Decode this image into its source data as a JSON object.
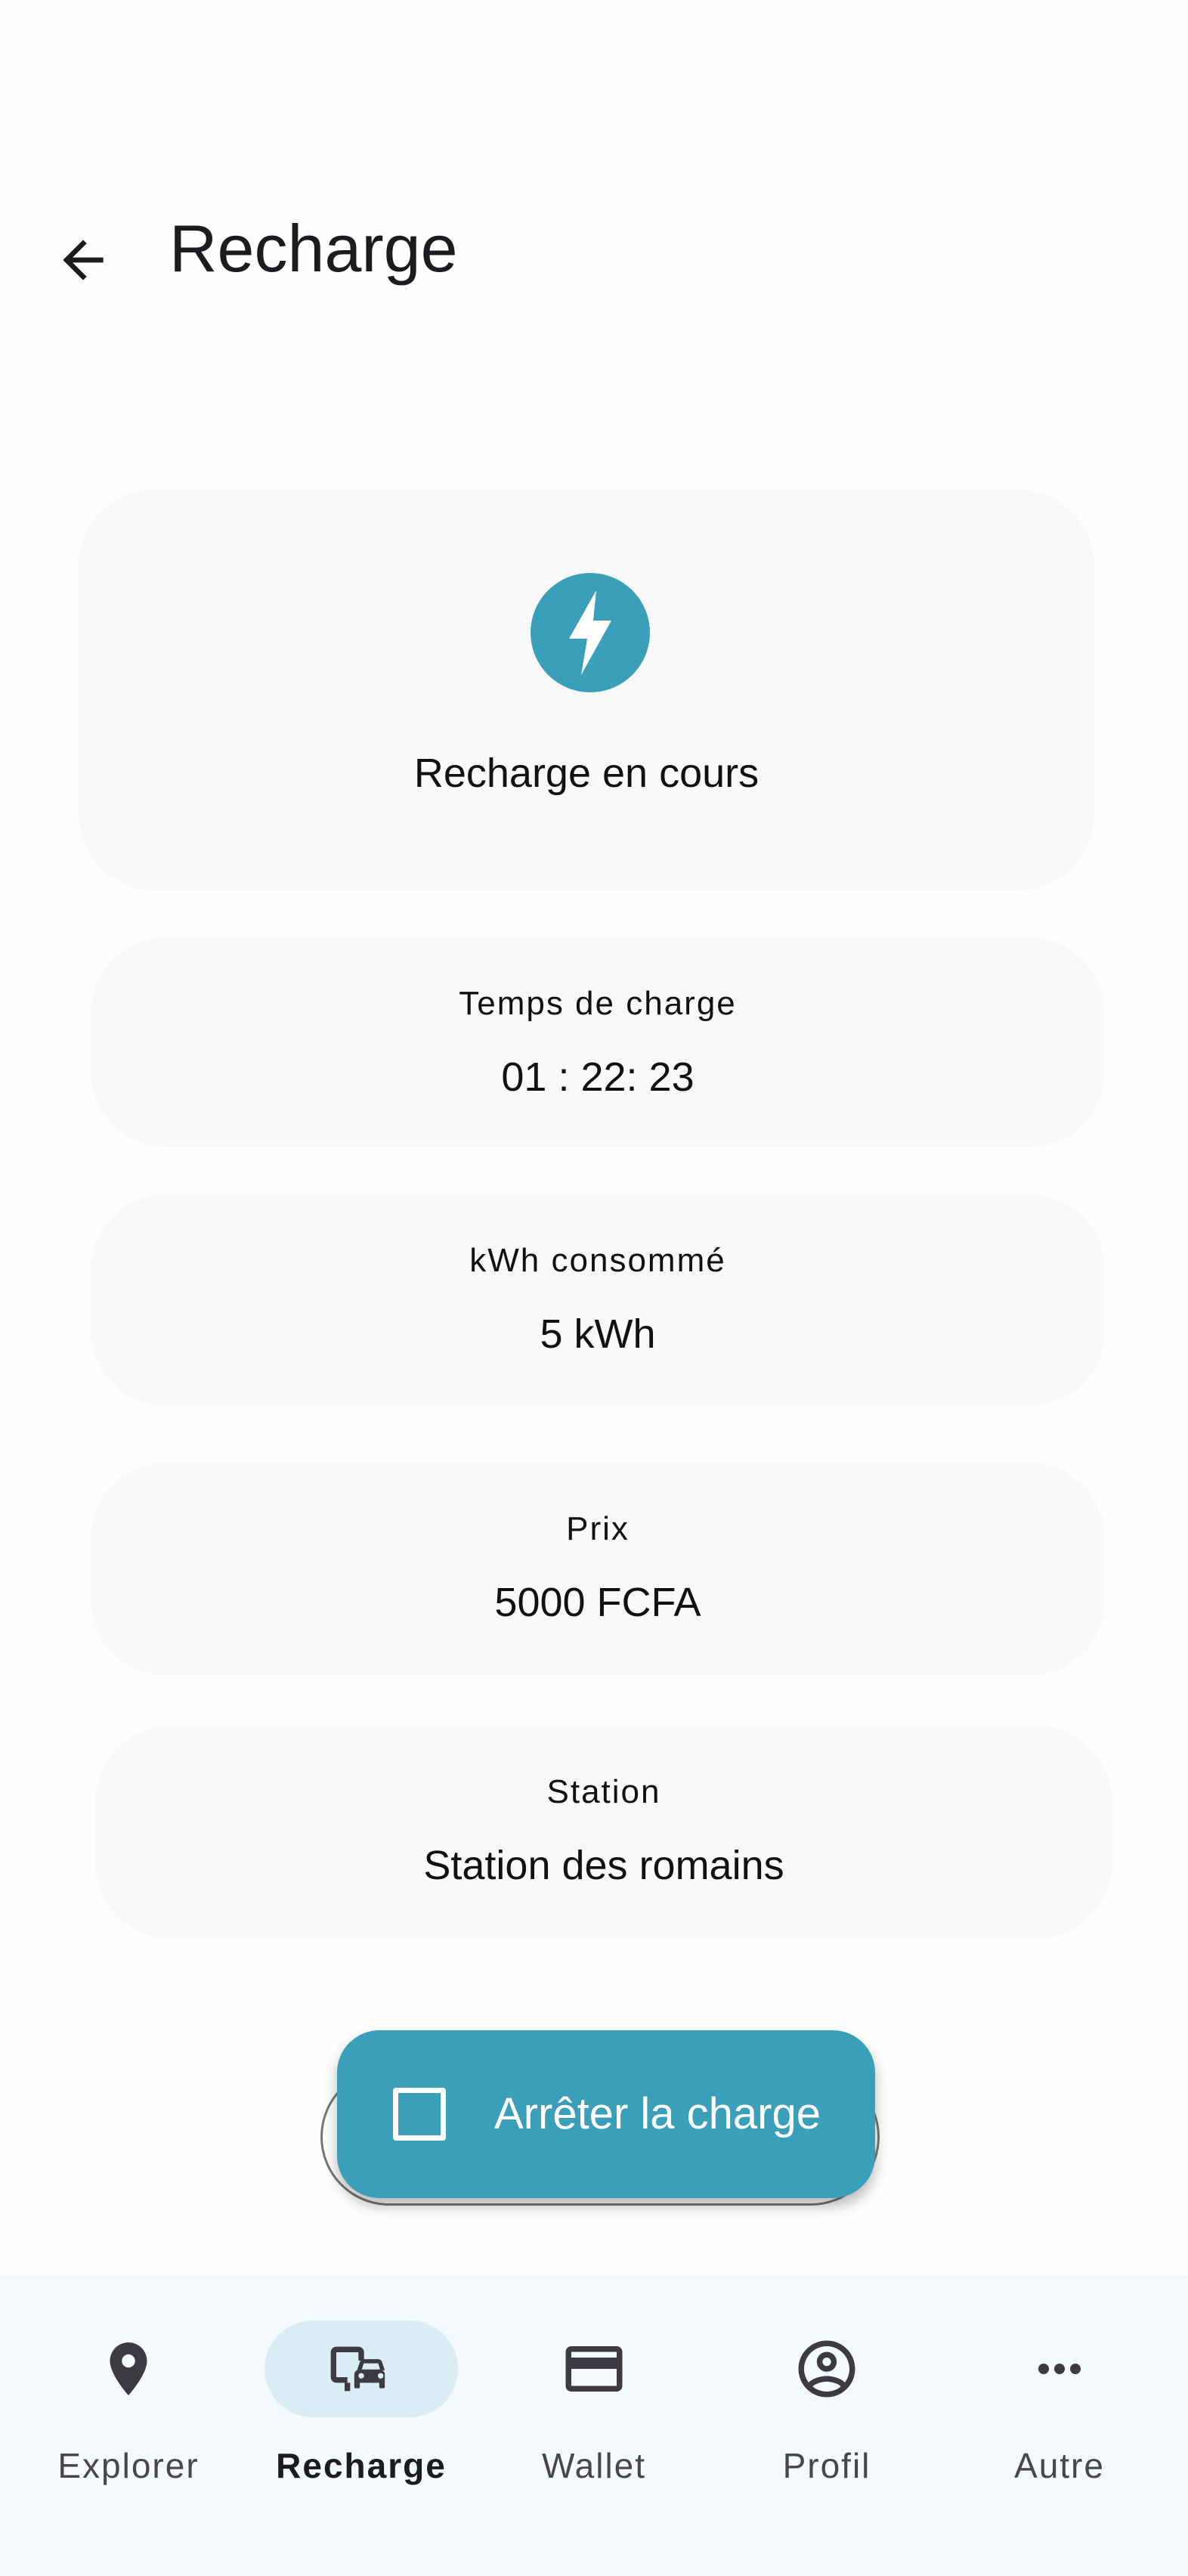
{
  "header": {
    "title": "Recharge",
    "back_icon": "arrow-back-icon"
  },
  "status": {
    "icon": "lightning-bolt-icon",
    "label": "Recharge en cours",
    "accent_color": "#3a9fb8"
  },
  "stats": {
    "charge_time": {
      "label": "Temps de charge",
      "value": "01 : 22: 23"
    },
    "kwh": {
      "label": "kWh consommé",
      "value": "5 kWh"
    },
    "price": {
      "label": "Prix",
      "value": "5000 FCFA"
    },
    "station": {
      "label": "Station",
      "value": "Station des romains"
    }
  },
  "stop_button": {
    "label": "Arrêter la charge",
    "icon": "stop-square-icon"
  },
  "bottom_nav": {
    "items": [
      {
        "label": "Explorer",
        "icon": "location-pin-icon",
        "active": false
      },
      {
        "label": "Recharge",
        "icon": "charging-car-icon",
        "active": true
      },
      {
        "label": "Wallet",
        "icon": "credit-card-icon",
        "active": false
      },
      {
        "label": "Profil",
        "icon": "account-circle-icon",
        "active": false
      },
      {
        "label": "Autre",
        "icon": "more-horiz-icon",
        "active": false
      }
    ]
  }
}
